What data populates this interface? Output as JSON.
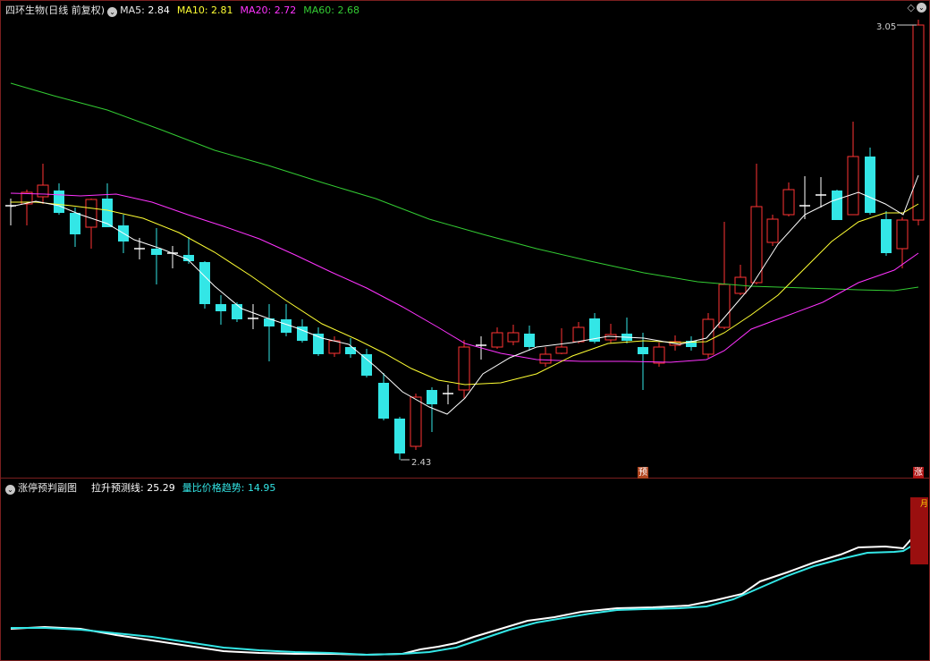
{
  "main_panel": {
    "stock_name": "四环生物(日线 前复权)",
    "indicator_icon": "chevron-down-icon",
    "ma": [
      {
        "label": "MA5:",
        "value": "2.84",
        "color": "#ffffff"
      },
      {
        "label": "MA10:",
        "value": "2.81",
        "color": "#ffff33"
      },
      {
        "label": "MA20:",
        "value": "2.72",
        "color": "#ff33ff"
      },
      {
        "label": "MA60:",
        "value": "2.68",
        "color": "#33cc33"
      }
    ],
    "high_label": "3.05",
    "low_label": "2.43",
    "tag_predict": "预",
    "tag_limit_up": "涨",
    "corner_icons": [
      "diamond-icon",
      "settings-circle-icon"
    ]
  },
  "sub_panel": {
    "title": "涨停预判副图",
    "line1_label": "拉升预测线:",
    "line1_value": "25.29",
    "line2_label": "量比价格趋势:",
    "line2_value": "14.95",
    "line1_color": "#ffffff",
    "line2_color": "#33e6e6",
    "block_text": "月"
  },
  "colors": {
    "up": "#ff3333",
    "down": "#33e6e6",
    "border": "#7a1f1f"
  }
}
